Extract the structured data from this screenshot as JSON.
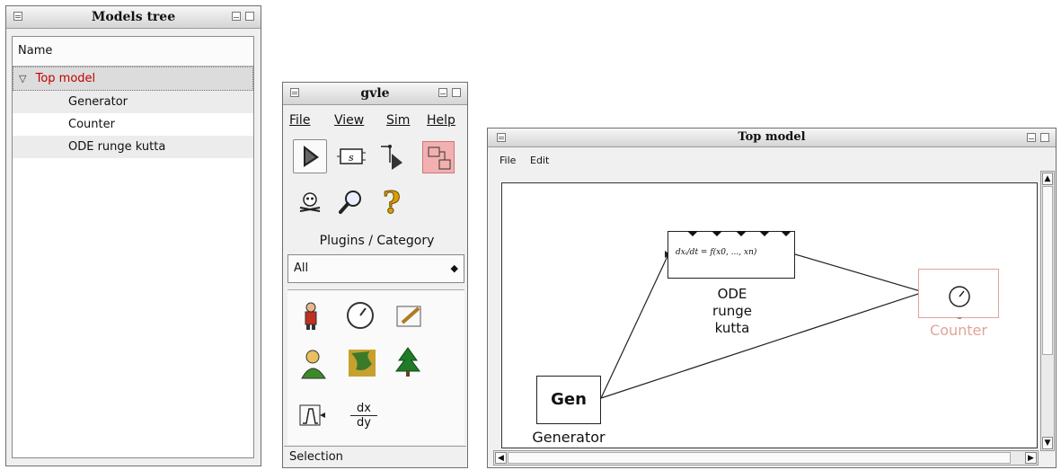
{
  "models_tree": {
    "title": "Models tree",
    "column_header": "Name",
    "items": [
      {
        "label": "Top model",
        "expanded": true,
        "selected": true
      },
      {
        "label": "Generator"
      },
      {
        "label": "Counter"
      },
      {
        "label": "ODE runge kutta"
      }
    ]
  },
  "gvle": {
    "title": "gvle",
    "menu": {
      "file": "File",
      "view": "View",
      "sim": "Sim",
      "help": "Help"
    },
    "tools": [
      {
        "icon": "arrow-select-icon",
        "selected": true
      },
      {
        "icon": "add-model-icon"
      },
      {
        "icon": "add-link-icon"
      },
      {
        "icon": "coupled-model-icon"
      },
      {
        "icon": "delete-icon"
      },
      {
        "icon": "zoom-icon"
      },
      {
        "icon": "question-icon"
      }
    ],
    "plugins_label": "Plugins / Category",
    "category_value": "All",
    "plugin_icons": [
      "person-icon",
      "clock-icon",
      "notepad-icon",
      "farmer-icon",
      "map-icon",
      "tree-icon",
      "signal-icon",
      "derivative-icon"
    ],
    "derivative_top": "dx",
    "derivative_bottom": "dy",
    "status": "Selection"
  },
  "top_model": {
    "title": "Top model",
    "menu": {
      "file": "File",
      "edit": "Edit"
    },
    "nodes": {
      "ode_formula": "dxᵢ/dt = f(x0, ..., xn)",
      "ode_name": [
        "ODE",
        "runge",
        "kutta"
      ],
      "generator_box": "Gen",
      "generator_name": "Generator",
      "counter_name": "Counter"
    },
    "colors": {
      "counter": "#e0a49a",
      "selected_tree": "#c00000"
    }
  }
}
